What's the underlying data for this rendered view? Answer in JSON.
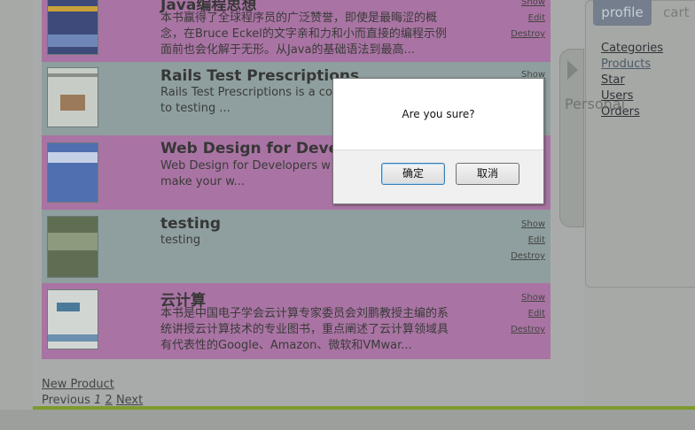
{
  "products": [
    {
      "title": "Java编程思想",
      "desc": "本书赢得了全球程序员的广泛赞誉，即使是最晦涩的概念，在Bruce Eckel的文字亲和力和小而直接的编程示例面前也会化解于无形。从Java的基础语法到最高..."
    },
    {
      "title": "Rails Test Prescriptions",
      "desc": "Rails Test Prescriptions is a co to testing ..."
    },
    {
      "title": "Web Design for Devel",
      "desc": "Web Design for Developers w make your w..."
    },
    {
      "title": "testing",
      "desc": "testing"
    },
    {
      "title": "云计算",
      "desc": "本书是中国电子学会云计算专家委员会刘鹏教授主编的系统讲授云计算技术的专业图书，重点阐述了云计算领域具有代表性的Google、Amazon、微软和VMwar..."
    }
  ],
  "actions": {
    "show": "Show",
    "edit": "Edit",
    "destroy": "Destroy"
  },
  "bottom": {
    "new_product": "New Product",
    "previous": "Previous",
    "page1": "1",
    "page2": "2",
    "next": "Next"
  },
  "sidebar": {
    "tab_profile": "profile",
    "tab_cart": "cart",
    "links": [
      "Categories",
      "Products",
      "Star",
      "Users",
      "Orders"
    ],
    "personal_label": "Personal"
  },
  "dialog": {
    "message": "Are you sure?",
    "ok": "确定",
    "cancel": "取消"
  }
}
